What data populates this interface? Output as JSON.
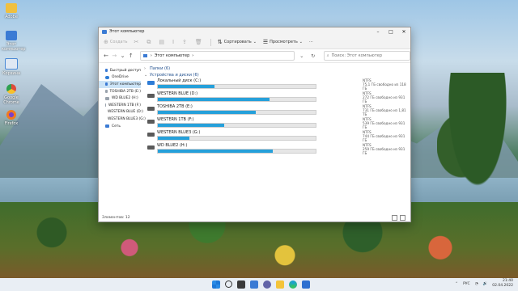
{
  "desktop": {
    "icons": [
      {
        "label": "Adobe",
        "icon": "folder-icon",
        "color": "#f0c040"
      },
      {
        "label": "Этот компьютер",
        "icon": "computer-icon",
        "color": "#3b7bd4"
      },
      {
        "label": "Корзина",
        "icon": "recycle-bin-icon",
        "color": "#4a8ad6"
      },
      {
        "label": "Google Chrome",
        "icon": "chrome-icon",
        "color": "#e04a3a"
      },
      {
        "label": "Firefox",
        "icon": "firefox-icon",
        "color": "#f07a20"
      }
    ]
  },
  "window": {
    "title": "Этот компьютер",
    "toolbar": {
      "new": "Создать",
      "sort": "Сортировать",
      "view": "Просмотреть",
      "more": "···"
    },
    "address": {
      "path": "Этот компьютер"
    },
    "search": {
      "placeholder": "Поиск: Этот компьютер"
    },
    "sidebar": [
      {
        "label": "Быстрый доступ",
        "icon": "star-icon",
        "color": "#3b7bd4"
      },
      {
        "label": "OneDrive",
        "icon": "cloud-icon",
        "color": "#2e7cd6"
      },
      {
        "label": "Этот компьютер",
        "icon": "computer-icon",
        "color": "#3b7bd4",
        "selected": true
      },
      {
        "label": "TOSHIBA 2TB (E:)",
        "icon": "drive-icon",
        "color": "#777777"
      },
      {
        "label": "WD BLUE2 (H:)",
        "icon": "drive-icon",
        "color": "#777777"
      },
      {
        "label": "WESTERN 1TB (F:)",
        "icon": "drive-icon",
        "color": "#777777"
      },
      {
        "label": "WESTERN BLUE (D:)",
        "icon": "drive-icon",
        "color": "#777777"
      },
      {
        "label": "WESTERN BLUE3 (G:)",
        "icon": "drive-icon",
        "color": "#777777"
      },
      {
        "label": "Сеть",
        "icon": "network-icon",
        "color": "#3b7bd4"
      }
    ],
    "groups": {
      "folders": "Папки (6)",
      "devices": "Устройства и диски (6)"
    },
    "drives": [
      {
        "name": "Локальный диск (C:)",
        "fs": "NTFS",
        "space": "75,1 ГБ свободно из 118 ГБ",
        "used_fraction": 0.36
      },
      {
        "name": "WESTERN BLUE (D:)",
        "fs": "NTFS",
        "space": "272 ГБ свободно из 931 ГБ",
        "used_fraction": 0.71
      },
      {
        "name": "TOSHIBA 2TB (E:)",
        "fs": "NTFS",
        "space": "731 ГБ свободно из 1,81 ТБ",
        "used_fraction": 0.62
      },
      {
        "name": "WESTERN 1TB (F:)",
        "fs": "NTFS",
        "space": "539 ГБ свободно из 931 ГБ",
        "used_fraction": 0.42
      },
      {
        "name": "WESTERN BLUE3 (G:)",
        "fs": "NTFS",
        "space": "744 ГБ свободно из 931 ГБ",
        "used_fraction": 0.2
      },
      {
        "name": "WD BLUE2 (H:)",
        "fs": "NTFS",
        "space": "259 ГБ свободно из 931 ГБ",
        "used_fraction": 0.73
      }
    ],
    "status": "Элементов: 12"
  },
  "taskbar": {
    "lang": "РУС",
    "time": "21:40",
    "date": "02.04.2022"
  }
}
